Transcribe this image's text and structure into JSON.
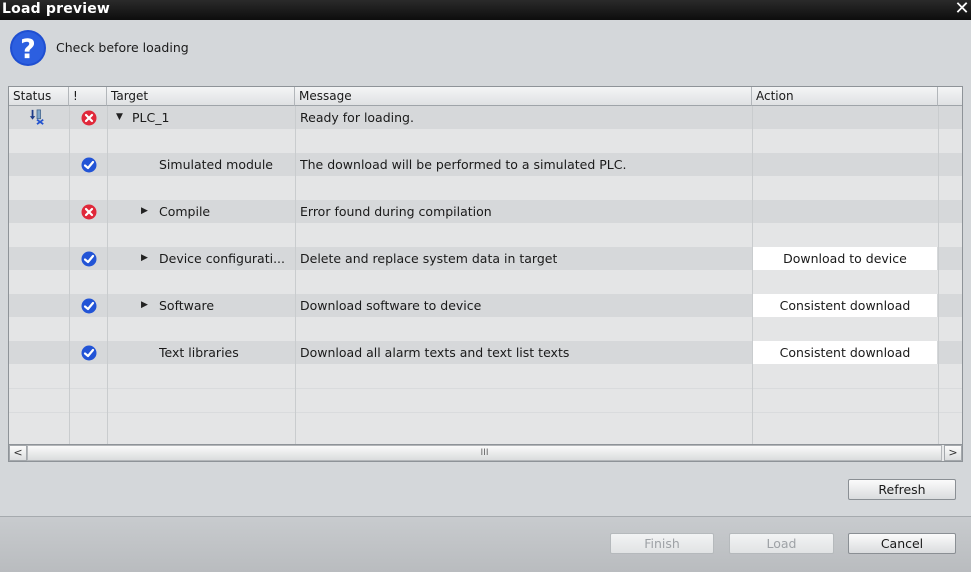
{
  "window": {
    "title": "Load preview",
    "close_glyph": "✕"
  },
  "header": {
    "text": "Check before loading",
    "icon": "question-icon"
  },
  "columns": {
    "status": "Status",
    "alert": "!",
    "target": "Target",
    "message": "Message",
    "action": "Action"
  },
  "rows": [
    {
      "alert_icon": "error-icon",
      "expander": "down",
      "target": "PLC_1",
      "message": "Ready for loading.",
      "action": ""
    },
    {
      "alert_icon": "check-icon",
      "expander": "",
      "target": "Simulated module",
      "message": "The download will be performed to a simulated PLC.",
      "action": ""
    },
    {
      "alert_icon": "error-icon",
      "expander": "right",
      "target": "Compile",
      "message": "Error found during compilation",
      "action": ""
    },
    {
      "alert_icon": "check-icon",
      "expander": "right",
      "target": "Device configurati...",
      "message": "Delete and replace system data in target",
      "action": "Download to device"
    },
    {
      "alert_icon": "check-icon",
      "expander": "right",
      "target": "Software",
      "message": "Download software to device",
      "action": "Consistent download"
    },
    {
      "alert_icon": "check-icon",
      "expander": "",
      "target": "Text libraries",
      "message": "Download all alarm texts and text list texts",
      "action": "Consistent download"
    }
  ],
  "scrollbar": {
    "left": "<",
    "right": ">",
    "grip": "III"
  },
  "buttons": {
    "refresh": "Refresh",
    "finish": "Finish",
    "load": "Load",
    "cancel": "Cancel"
  },
  "colors": {
    "check": "#2254d6",
    "error": "#e0283a",
    "titlebar": "#111111"
  }
}
